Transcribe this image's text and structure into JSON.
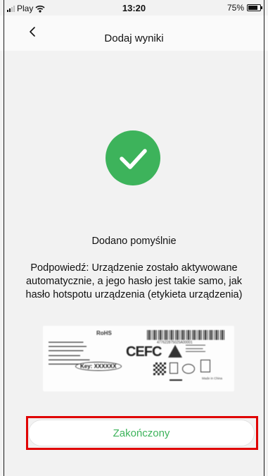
{
  "status_bar": {
    "carrier": "Play",
    "time": "13:20",
    "battery": "75%"
  },
  "nav": {
    "title": "Dodaj wyniki"
  },
  "main": {
    "success_message": "Dodano pomyślnie",
    "hint": "Podpowiedź: Urządzenie zostało aktywowane automatycznie, a jego hasło jest takie samo, jak hasło hotspotu urządzenia (etykieta urządzenia)",
    "label_image": {
      "key_text": "Key: XXXXXX",
      "rohs_text": "RoHS",
      "barcode_number": "477622875025A00001",
      "ce_fc_text": "CEFC",
      "made_in": "Made in China"
    }
  },
  "footer": {
    "finish_label": "Zakończony"
  },
  "colors": {
    "accent_green": "#3db35b",
    "highlight_red": "#e00000",
    "background": "#f2f2f2"
  },
  "icons": {
    "back": "chevron-left-icon",
    "success": "checkmark-circle-icon",
    "wifi": "wifi-icon",
    "battery": "battery-icon",
    "signal": "signal-icon"
  }
}
